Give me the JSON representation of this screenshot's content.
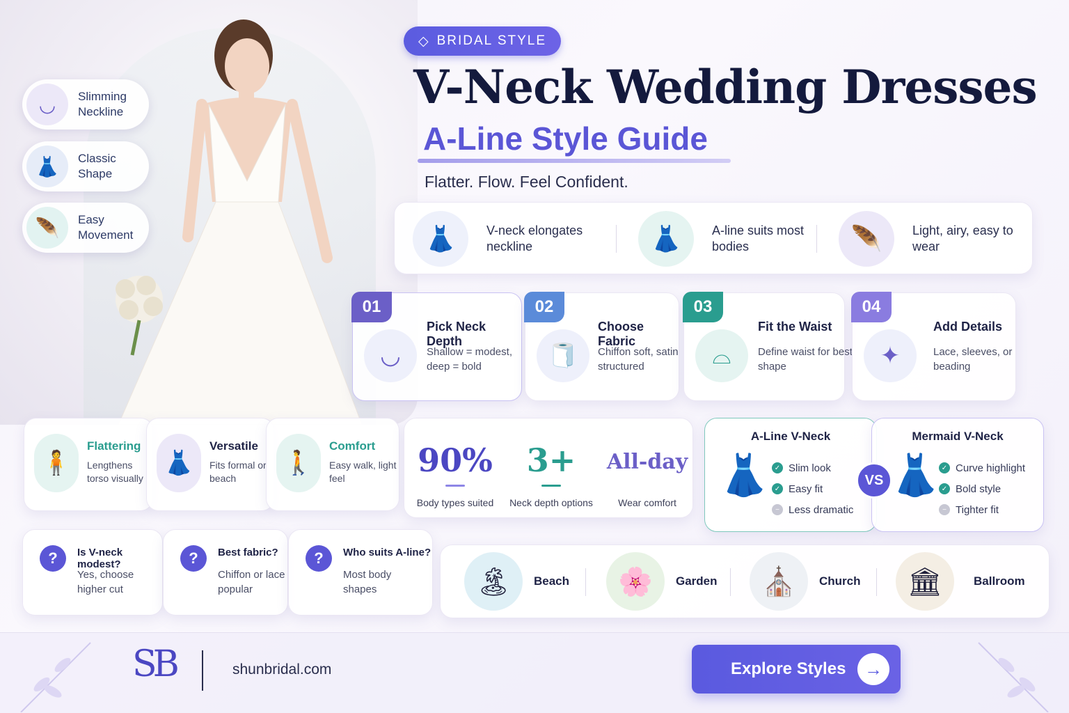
{
  "badge": {
    "icon": "diamond-icon",
    "label": "BRIDAL STYLE"
  },
  "title": "V-Neck Wedding Dresses",
  "subtitle": "A-Line Style Guide",
  "tagline": "Flatter. Flow. Feel Confident.",
  "side_pills": [
    {
      "icon": "neckline-icon",
      "label": "Slimming Neckline"
    },
    {
      "icon": "dress-icon",
      "label": "Classic Shape"
    },
    {
      "icon": "feather-icon",
      "label": "Easy Movement"
    }
  ],
  "features": [
    {
      "icon": "dress-outline-icon",
      "label": "V-neck elongates neckline"
    },
    {
      "icon": "aline-dress-icon",
      "label": "A-line suits most bodies"
    },
    {
      "icon": "feather-icon",
      "label": "Light, airy, easy to wear"
    }
  ],
  "steps": [
    {
      "num": "01",
      "title": "Pick Neck Depth",
      "text": "Shallow = modest, deep = bold",
      "icon": "neckline-icon"
    },
    {
      "num": "02",
      "title": "Choose Fabric",
      "text": "Chiffon soft, satin structured",
      "icon": "fabric-roll-icon"
    },
    {
      "num": "03",
      "title": "Fit the Waist",
      "text": "Define waist for best shape",
      "icon": "waist-icon"
    },
    {
      "num": "04",
      "title": "Add Details",
      "text": "Lace, sleeves, or beading",
      "icon": "sparkle-icon"
    }
  ],
  "benefits": [
    {
      "icon": "silhouette-icon",
      "title": "Flattering",
      "text": "Lengthens torso visually"
    },
    {
      "icon": "hanger-dress-icon",
      "title": "Versatile",
      "text": "Fits formal or beach"
    },
    {
      "icon": "walking-icon",
      "title": "Comfort",
      "text": "Easy walk, light feel"
    }
  ],
  "stats": [
    {
      "value": "90%",
      "label": "Body types suited"
    },
    {
      "value": "3+",
      "label": "Neck depth options"
    },
    {
      "value": "All-day",
      "label": "Wear comfort"
    }
  ],
  "comparison": {
    "vs_label": "VS",
    "left": {
      "title": "A-Line V-Neck",
      "items": [
        {
          "text": "Slim look",
          "type": "check"
        },
        {
          "text": "Easy fit",
          "type": "check"
        },
        {
          "text": "Less dramatic",
          "type": "minus"
        }
      ]
    },
    "right": {
      "title": "Mermaid V-Neck",
      "items": [
        {
          "text": "Curve highlight",
          "type": "check"
        },
        {
          "text": "Bold style",
          "type": "check"
        },
        {
          "text": "Tighter fit",
          "type": "minus"
        }
      ]
    }
  },
  "faq": [
    {
      "q": "Is V-neck modest?",
      "a": "Yes, choose higher cut"
    },
    {
      "q": "Best fabric?",
      "a": "Chiffon or lace popular"
    },
    {
      "q": "Who suits A-line?",
      "a": "Most body shapes"
    }
  ],
  "venues": [
    {
      "icon": "beach-icon",
      "label": "Beach"
    },
    {
      "icon": "garden-arch-icon",
      "label": "Garden"
    },
    {
      "icon": "church-icon",
      "label": "Church"
    },
    {
      "icon": "ballroom-icon",
      "label": "Ballroom"
    }
  ],
  "footer": {
    "logo": "SB",
    "site": "shunbridal.com",
    "cta": "Explore Styles"
  },
  "colors": {
    "primary": "#5b56d6",
    "teal": "#2a9d8f",
    "navy": "#141a3d"
  }
}
